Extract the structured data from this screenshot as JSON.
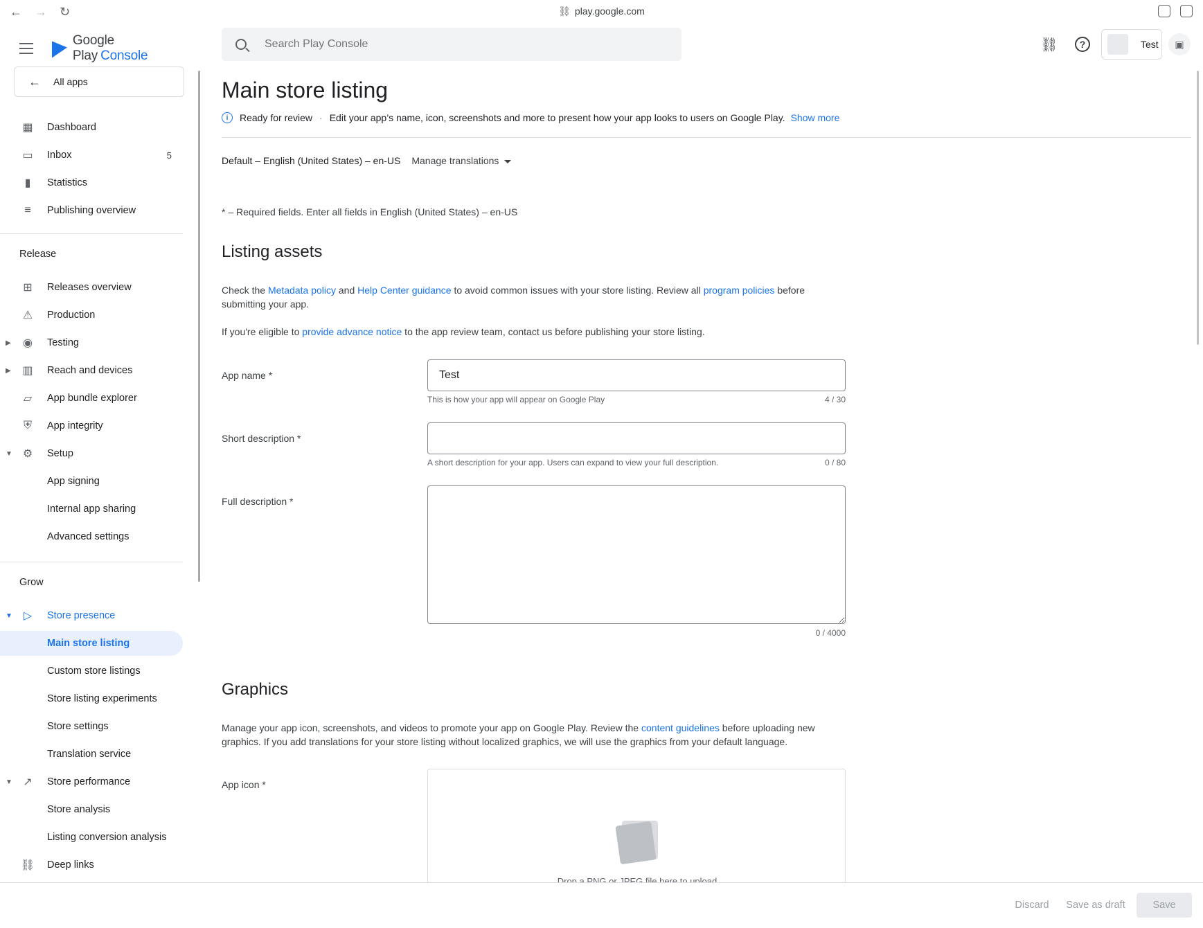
{
  "browser": {
    "url": "play.google.com"
  },
  "brand": {
    "name": "Google Play",
    "product": "Console"
  },
  "sidebar": {
    "all_apps": "All apps",
    "top_items": [
      {
        "label": "Dashboard"
      },
      {
        "label": "Inbox",
        "count": "5"
      },
      {
        "label": "Statistics"
      },
      {
        "label": "Publishing overview"
      }
    ],
    "release_heading": "Release",
    "release_items": [
      {
        "label": "Releases overview"
      },
      {
        "label": "Production"
      },
      {
        "label": "Testing"
      },
      {
        "label": "Reach and devices"
      },
      {
        "label": "App bundle explorer"
      },
      {
        "label": "App integrity"
      },
      {
        "label": "Setup"
      },
      {
        "label": "App signing"
      },
      {
        "label": "Internal app sharing"
      },
      {
        "label": "Advanced settings"
      }
    ],
    "grow_heading": "Grow",
    "grow_items": [
      {
        "label": "Store presence"
      },
      {
        "label": "Main store listing"
      },
      {
        "label": "Custom store listings"
      },
      {
        "label": "Store listing experiments"
      },
      {
        "label": "Store settings"
      },
      {
        "label": "Translation service"
      },
      {
        "label": "Store performance"
      },
      {
        "label": "Store analysis"
      },
      {
        "label": "Listing conversion analysis"
      },
      {
        "label": "Deep links"
      }
    ]
  },
  "header": {
    "search_placeholder": "Search Play Console",
    "account_name": "Test"
  },
  "main": {
    "title": "Main store listing",
    "status": "Ready for review",
    "status_desc": "Edit your app’s name, icon, screenshots and more to present how your app looks to users on Google Play.",
    "show_more": "Show more",
    "locale": "Default – English (United States) – en-US",
    "manage_translations": "Manage translations",
    "required_note": "* – Required fields. Enter all fields in English (United States) – en-US",
    "listing_assets": {
      "heading": "Listing assets",
      "p1_a": "Check the ",
      "p1_link1": "Metadata policy",
      "p1_b": " and ",
      "p1_link2": "Help Center guidance",
      "p1_c": " to avoid common issues with your store listing. Review all ",
      "p1_link3": "program policies",
      "p1_d": " before submitting your app.",
      "p2_a": "If you're eligible to ",
      "p2_link": "provide advance notice",
      "p2_b": " to the app review team, contact us before publishing your store listing."
    },
    "fields": {
      "app_name_label": "App name  *",
      "app_name_value": "Test",
      "app_name_help": "This is how your app will appear on Google Play",
      "app_name_count": "4 / 30",
      "short_desc_label": "Short description  *",
      "short_desc_value": "",
      "short_desc_help": "A short description for your app. Users can expand to view your full description.",
      "short_desc_count": "0 / 80",
      "full_desc_label": "Full description  *",
      "full_desc_value": "",
      "full_desc_count": "0 / 4000"
    },
    "graphics": {
      "heading": "Graphics",
      "p_a": "Manage your app icon, screenshots, and videos to promote your app on Google Play. Review the ",
      "p_link": "content guidelines",
      "p_b": " before uploading new graphics. If you add translations for your store listing without localized graphics, we will use the graphics from your default language.",
      "app_icon_label": "App icon  *",
      "drop_text": "Drop a PNG or JPEG file here to upload"
    }
  },
  "footer": {
    "discard": "Discard",
    "save_draft": "Save as draft",
    "save": "Save"
  },
  "colors": {
    "accent": "#1a73e8",
    "active_bg": "#e8f0fe"
  }
}
